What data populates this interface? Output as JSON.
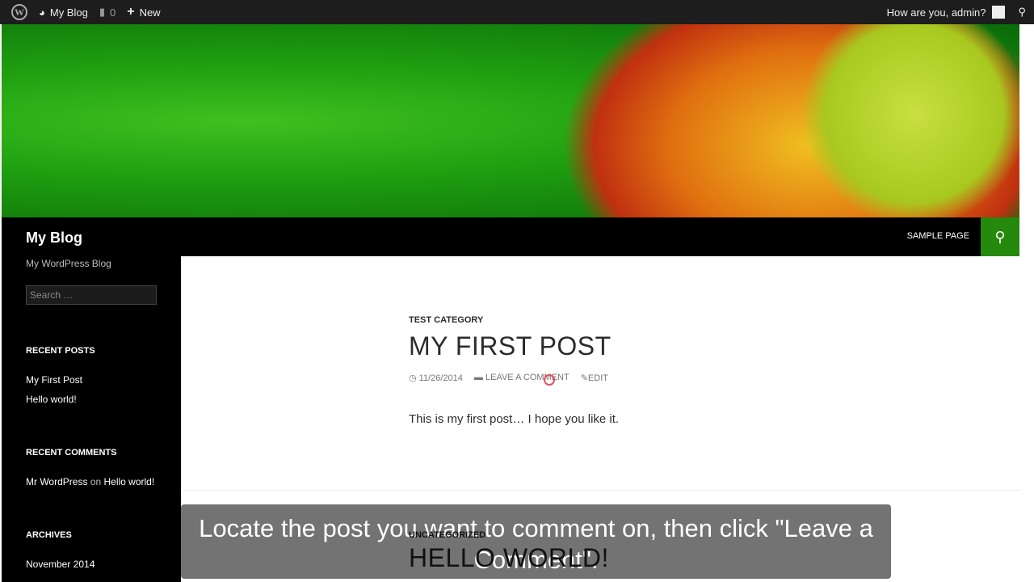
{
  "adminbar": {
    "site": "My Blog",
    "comments": "0",
    "new": "New",
    "greeting": "How are you, admin?"
  },
  "site": {
    "title": "My Blog",
    "tagline": "My WordPress Blog",
    "search_placeholder": "Search …"
  },
  "nav": {
    "sample_page": "SAMPLE PAGE"
  },
  "widgets": {
    "recent_posts_title": "RECENT POSTS",
    "recent_posts": [
      "My First Post",
      "Hello world!"
    ],
    "recent_comments_title": "RECENT COMMENTS",
    "comment_author": "Mr WordPress",
    "comment_on": "on",
    "comment_post": "Hello world!",
    "archives_title": "ARCHIVES",
    "archives": [
      "November 2014"
    ]
  },
  "posts": [
    {
      "category": "TEST CATEGORY",
      "title": "MY FIRST POST",
      "date": "11/26/2014",
      "comment_link": "LEAVE A COMMENT",
      "edit": "EDIT",
      "content": "This is my first post… I hope you like it."
    },
    {
      "category": "UNCATEGORIZED",
      "title": "HELLO WORLD!"
    }
  ],
  "caption": "Locate the post you want to comment on, then click \"Leave a Comment\".",
  "colors": {
    "accent": "#24890d",
    "adminbar": "#1d1d1d"
  }
}
